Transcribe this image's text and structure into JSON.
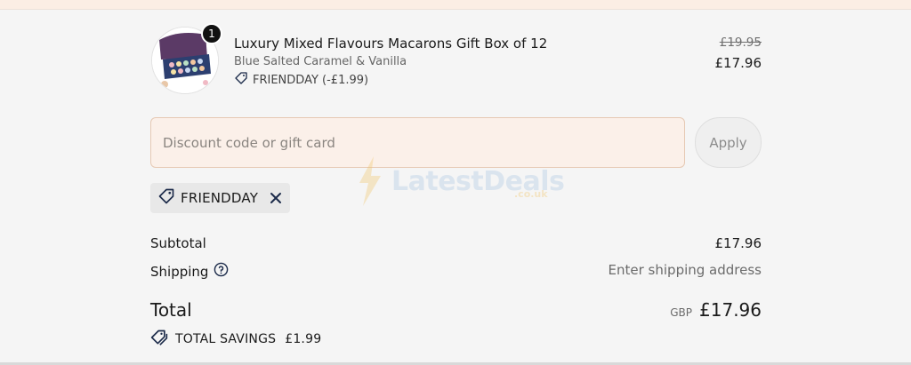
{
  "product": {
    "quantity": "1",
    "title": "Luxury Mixed Flavours Macarons Gift Box of 12",
    "variant": "Blue Salted Caramel & Vanilla",
    "discount_line": "FRIENDDAY (-£1.99)",
    "original_price": "£19.95",
    "price": "£17.96"
  },
  "discount": {
    "placeholder": "Discount code or gift card",
    "apply_label": "Apply",
    "applied_code": "FRIENDDAY"
  },
  "watermark": {
    "text": "LatestDeals",
    "sub": ".co.uk"
  },
  "summary": {
    "subtotal_label": "Subtotal",
    "subtotal_value": "£17.96",
    "shipping_label": "Shipping",
    "shipping_value": "Enter shipping address",
    "total_label": "Total",
    "currency": "GBP",
    "total_value": "£17.96",
    "savings_label": "TOTAL SAVINGS",
    "savings_value": "£1.99"
  },
  "colors": {
    "field_bg": "#fbf0e9",
    "field_border": "#e6c9b4",
    "page_bg": "#f5f5f5",
    "badge_bg": "#111111"
  },
  "icons": [
    "tag-icon",
    "close-icon",
    "help-circle-icon",
    "tags-icon"
  ]
}
